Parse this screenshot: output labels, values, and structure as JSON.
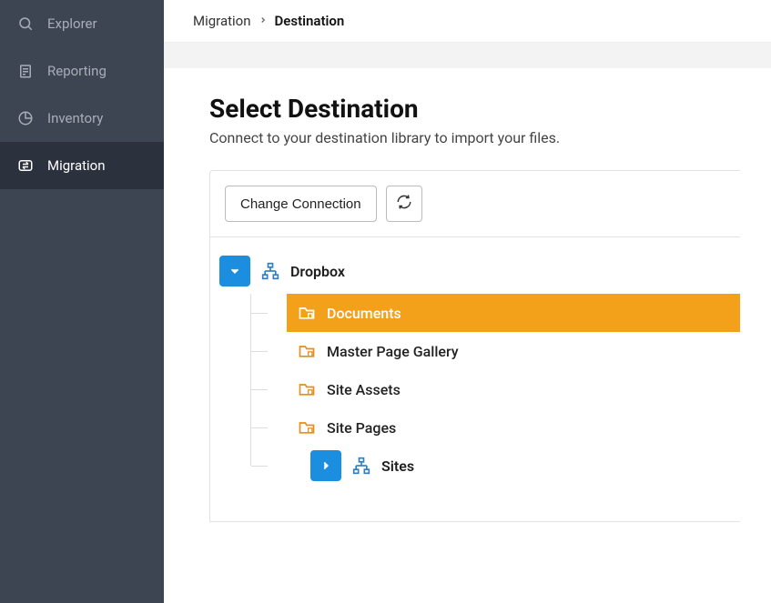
{
  "sidebar": {
    "items": [
      {
        "label": "Explorer"
      },
      {
        "label": "Reporting"
      },
      {
        "label": "Inventory"
      },
      {
        "label": "Migration"
      }
    ]
  },
  "breadcrumb": {
    "items": [
      {
        "label": "Migration"
      },
      {
        "label": "Destination"
      }
    ]
  },
  "page": {
    "title": "Select Destination",
    "subtitle": "Connect to your destination library to import your files."
  },
  "toolbar": {
    "change_connection": "Change Connection"
  },
  "tree": {
    "root": {
      "label": "Dropbox",
      "children": [
        {
          "label": "Documents",
          "selected": true
        },
        {
          "label": "Master Page Gallery"
        },
        {
          "label": "Site Assets"
        },
        {
          "label": "Site Pages"
        },
        {
          "label": "Sites",
          "has_children": true
        }
      ]
    }
  }
}
